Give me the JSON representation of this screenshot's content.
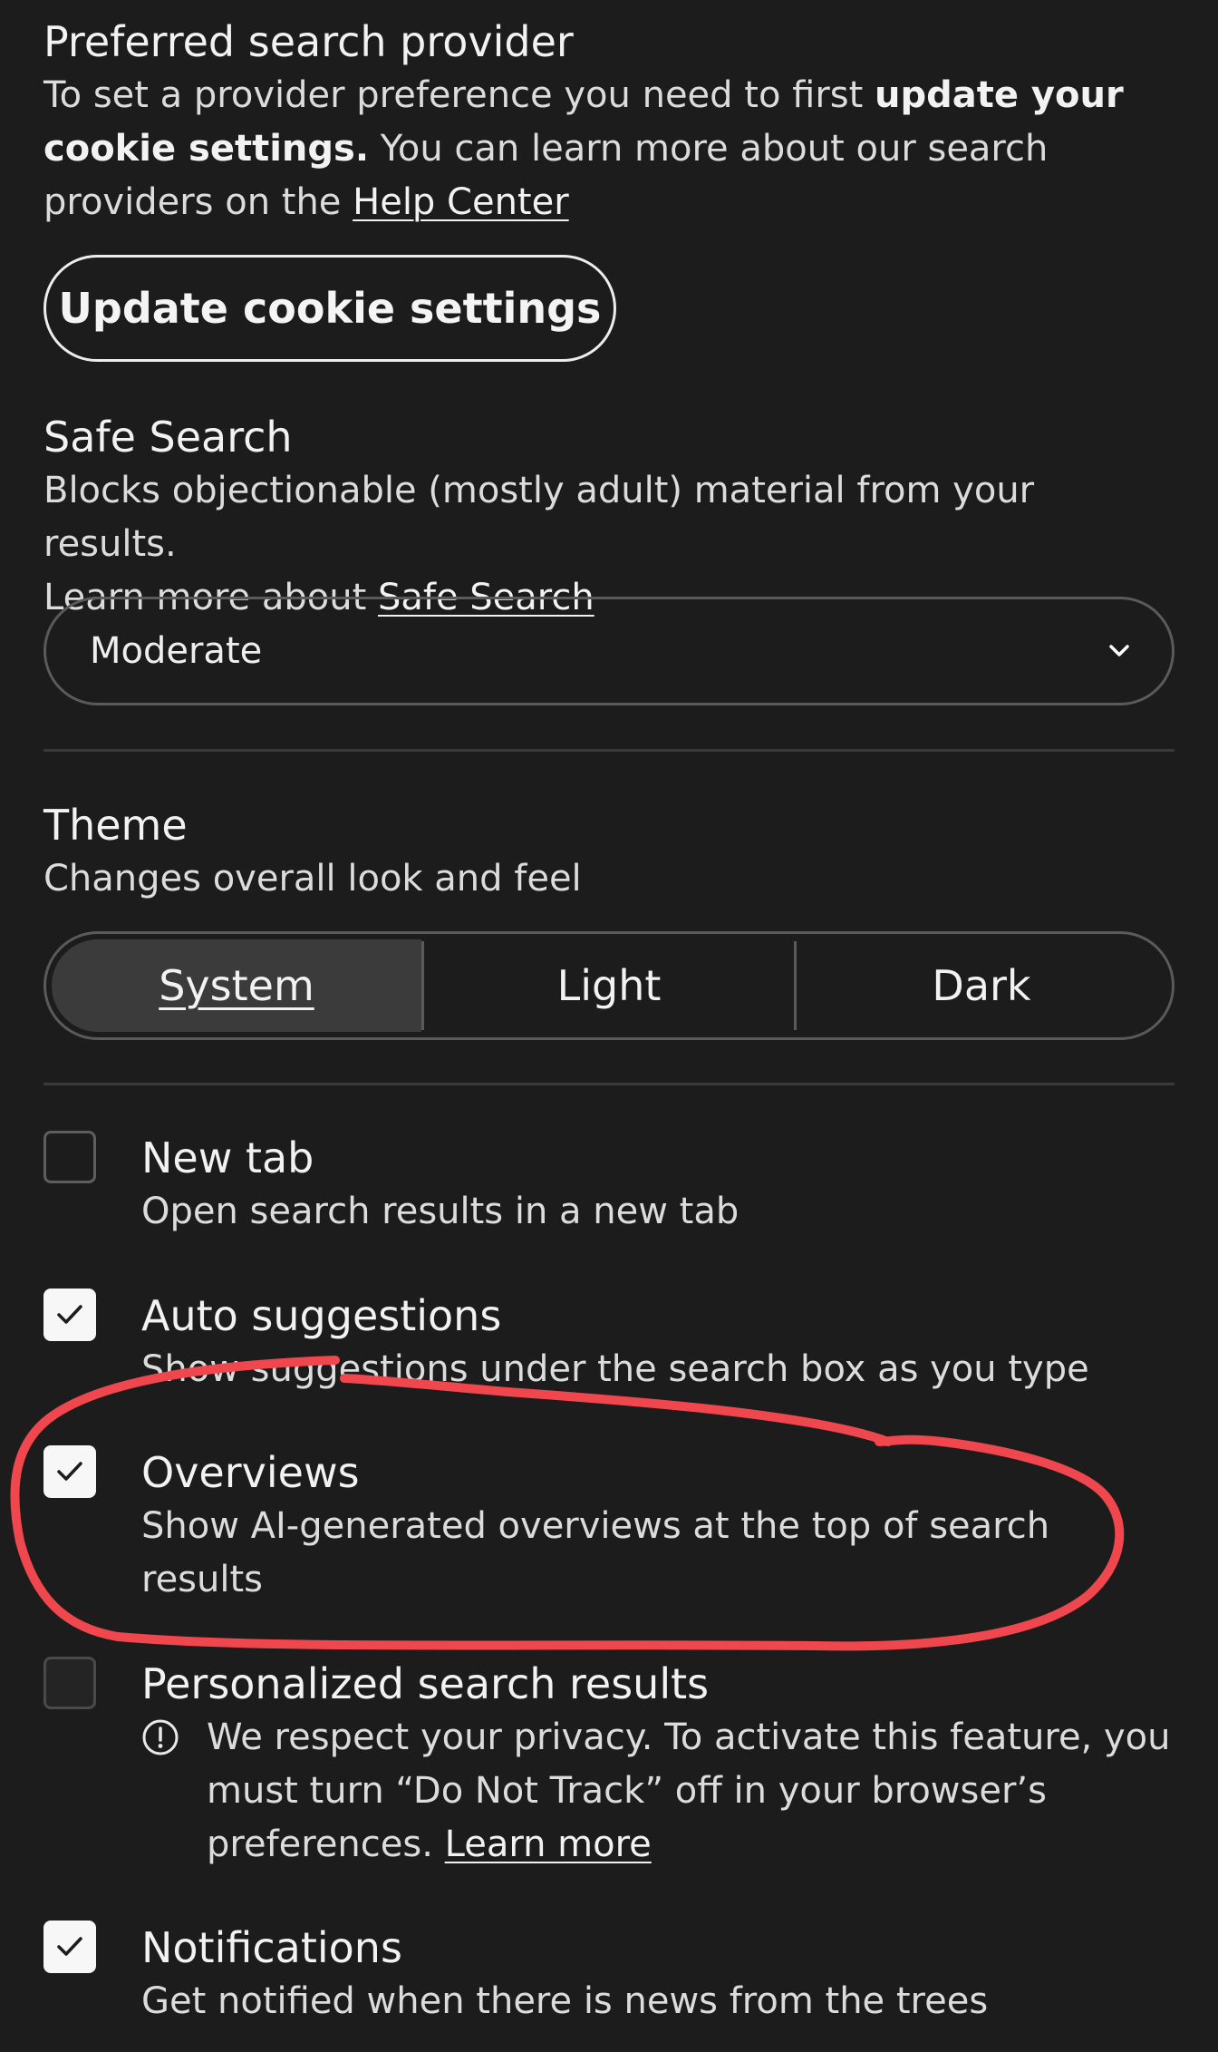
{
  "search_provider": {
    "title": "Preferred search provider",
    "desc_prefix": "To set a provider preference you need to first ",
    "desc_bold_line1": "update your",
    "desc_bold_line2": "cookie settings.",
    "desc_middle": " You can learn more about our search",
    "desc_line3_prefix": "providers on the ",
    "help_link": "Help Center",
    "button_label": "Update cookie settings"
  },
  "safe_search": {
    "title": "Safe Search",
    "desc_line1": "Blocks objectionable (mostly adult) material from your results.",
    "desc_line2_prefix": "Learn more about ",
    "link": "Safe Search",
    "selected": "Moderate"
  },
  "theme": {
    "title": "Theme",
    "desc": "Changes overall look and feel",
    "options": [
      "System",
      "Light",
      "Dark"
    ],
    "selected": "System"
  },
  "options": {
    "new_tab": {
      "label": "New tab",
      "desc": "Open search results in a new tab",
      "checked": false
    },
    "auto_suggestions": {
      "label": "Auto suggestions",
      "desc": "Show suggestions under the search box as you type",
      "checked": true
    },
    "overviews": {
      "label": "Overviews",
      "desc_line1": "Show AI-generated overviews at the top of search",
      "desc_line2": "results",
      "checked": true
    },
    "personalized": {
      "label": "Personalized search results",
      "info_line1": "We respect your privacy. To activate this feature, you",
      "info_line2": "must turn “Do Not Track” off in your browser’s",
      "info_line3_prefix": "preferences. ",
      "info_link": "Learn more",
      "checked": false
    },
    "notifications": {
      "label": "Notifications",
      "desc": "Get notified when there is news from the trees",
      "checked": true
    }
  },
  "colors": {
    "background": "#1c1c1c",
    "annotation": "#f0474f",
    "checkbox_checked": "#f7f7f7"
  },
  "icons": {
    "dropdown": "chevron-down-icon",
    "check": "checkmark-icon",
    "info": "info-circle-icon"
  }
}
